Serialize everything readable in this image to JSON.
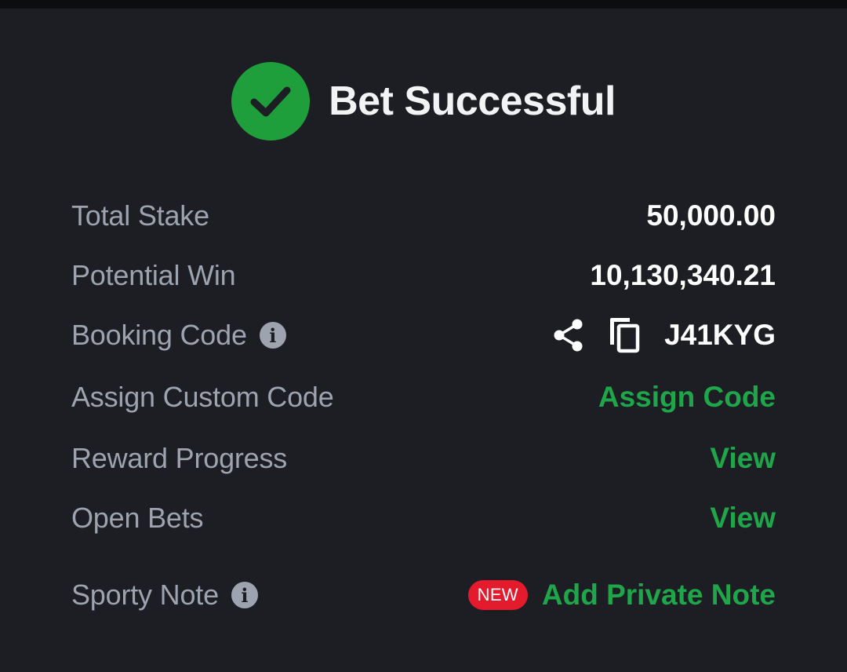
{
  "header": {
    "title": "Bet Successful",
    "icon": "check-circle-icon",
    "icon_color": "#1f9e3c"
  },
  "rows": {
    "total_stake": {
      "label": "Total Stake",
      "value": "50,000.00"
    },
    "potential_win": {
      "label": "Potential Win",
      "value": "10,130,340.21"
    },
    "booking_code": {
      "label": "Booking Code",
      "value": "J41KYG"
    },
    "assign_custom_code": {
      "label": "Assign Custom Code",
      "action": "Assign Code"
    },
    "reward_progress": {
      "label": "Reward Progress",
      "action": "View"
    },
    "open_bets": {
      "label": "Open Bets",
      "action": "View"
    },
    "sporty_note": {
      "label": "Sporty Note",
      "badge": "NEW",
      "action": "Add Private Note"
    }
  },
  "colors": {
    "background": "#1c1e24",
    "accent_green": "#1fa64a",
    "badge_red": "#e41b2c",
    "label_gray": "#9ea3b0"
  }
}
